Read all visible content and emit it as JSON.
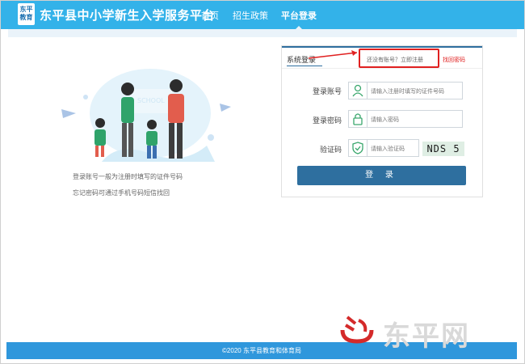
{
  "header": {
    "logo_text": "东平教育",
    "site_title": "东平县中小学新生入学服务平台",
    "nav": [
      {
        "label": "首页"
      },
      {
        "label": "招生政策"
      },
      {
        "label": "平台登录",
        "active": true
      }
    ]
  },
  "illustration": {
    "school_label": "SCHOOL"
  },
  "tips": [
    "登录账号一般为注册时填写的证件号码",
    "忘记密码可通过手机号码短信找回"
  ],
  "login": {
    "title": "系统登录",
    "register_prompt": "还没有账号？立即注册",
    "forgot_link": "找回密码",
    "account_label": "登录账号",
    "account_placeholder": "请输入注册时填写的证件号码",
    "password_label": "登录密码",
    "password_placeholder": "请输入密码",
    "captcha_label": "验证码",
    "captcha_placeholder": "请输入验证码",
    "captcha_value": "NDS 5",
    "submit_label": "登 录"
  },
  "footer": {
    "copyright": "©2020 东平县教育和体育局"
  },
  "watermark": {
    "text": "东平网"
  },
  "colors": {
    "header_bg": "#33b2e9",
    "button_bg": "#2e6f9f",
    "highlight": "#e02020"
  }
}
